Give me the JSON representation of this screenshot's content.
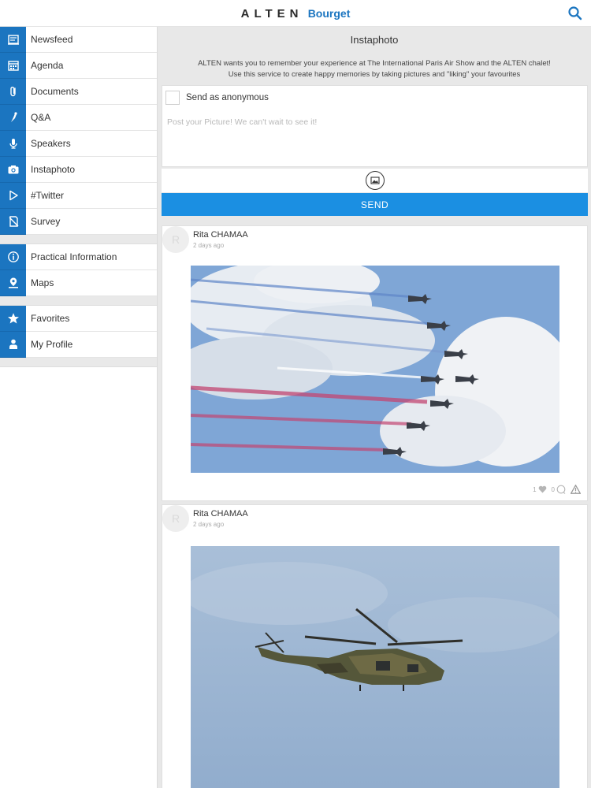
{
  "header": {
    "brand": "ALTEN",
    "brand_suffix": "Bourget",
    "search_icon": "search-icon"
  },
  "sidebar": {
    "groups": [
      [
        {
          "label": "Newsfeed",
          "icon": "newsfeed-icon"
        },
        {
          "label": "Agenda",
          "icon": "calendar-icon"
        },
        {
          "label": "Documents",
          "icon": "paperclip-icon"
        },
        {
          "label": "Q&A",
          "icon": "qa-icon"
        },
        {
          "label": "Speakers",
          "icon": "microphone-icon"
        },
        {
          "label": "Instaphoto",
          "icon": "camera-icon"
        },
        {
          "label": "#Twitter",
          "icon": "play-icon"
        },
        {
          "label": "Survey",
          "icon": "survey-icon"
        }
      ],
      [
        {
          "label": "Practical Information",
          "icon": "info-icon"
        },
        {
          "label": "Maps",
          "icon": "map-pin-icon"
        }
      ],
      [
        {
          "label": "Favorites",
          "icon": "star-icon"
        },
        {
          "label": "My Profile",
          "icon": "profile-icon"
        }
      ]
    ]
  },
  "main": {
    "title": "Instaphoto",
    "intro_line1": "ALTEN wants you to remember your experience at The International Paris Air Show and the ALTEN chalet!",
    "intro_line2": "Use this service to create happy memories by taking pictures and \"liking\" your favourites",
    "anonymous_label": "Send as anonymous",
    "post_placeholder": "Post your Picture! We can't wait to see it!",
    "send_label": "SEND",
    "posts": [
      {
        "avatar": "R",
        "author": "Rita CHAMAA",
        "time": "2 days ago",
        "likes": "1",
        "comments": "0"
      },
      {
        "avatar": "R",
        "author": "Rita CHAMAA",
        "time": "2 days ago"
      }
    ]
  },
  "colors": {
    "accent": "#1b75c0",
    "send": "#1b8fe2",
    "background": "#e8e8e8"
  }
}
